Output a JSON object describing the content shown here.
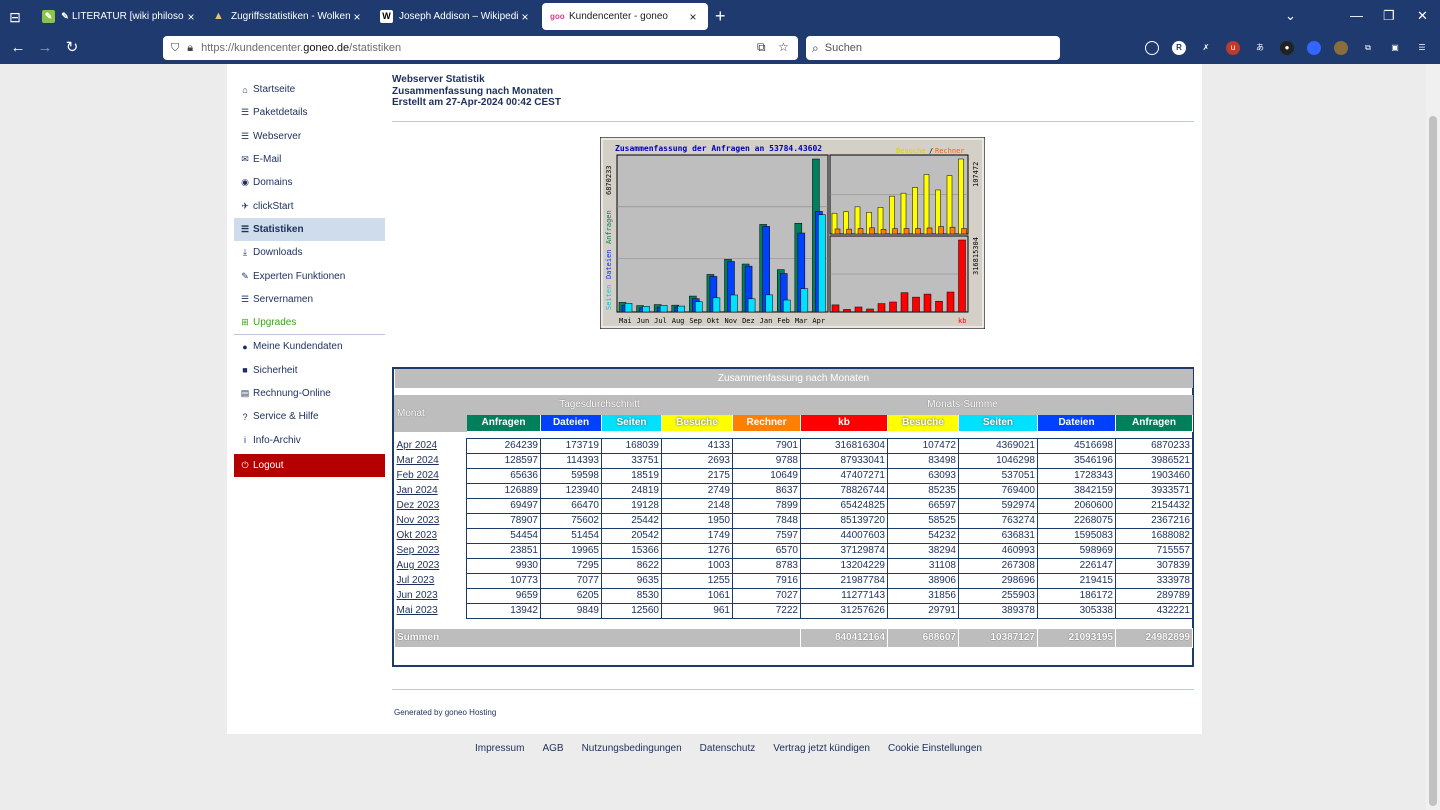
{
  "browser": {
    "tabs": [
      {
        "title": "LITERATUR [wiki philosophie",
        "close": "×"
      },
      {
        "title": "Zugriffsstatistiken - Wolkenstein",
        "close": "×"
      },
      {
        "title": "Joseph Addison – Wikipedia",
        "close": "×"
      },
      {
        "title": "Kundencenter - goneo",
        "close": "×"
      }
    ],
    "new_tab": "+",
    "url_prefix": "https://kundencenter.",
    "url_domain": "goneo.de",
    "url_path": "/statistiken",
    "search_placeholder": "Suchen"
  },
  "sidebar": {
    "items": [
      {
        "label": "Startseite",
        "icon": "home-icon",
        "glyph": "⌂"
      },
      {
        "label": "Paketdetails",
        "icon": "list-icon",
        "glyph": "☰"
      },
      {
        "label": "Webserver",
        "icon": "server-icon",
        "glyph": "☰"
      },
      {
        "label": "E-Mail",
        "icon": "mail-icon",
        "glyph": "✉"
      },
      {
        "label": "Domains",
        "icon": "globe-icon",
        "glyph": "◉"
      },
      {
        "label": "clickStart",
        "icon": "rocket-icon",
        "glyph": "✈"
      },
      {
        "label": "Statistiken",
        "icon": "stats-icon",
        "glyph": "☰"
      },
      {
        "label": "Downloads",
        "icon": "download-icon",
        "glyph": "⤓"
      },
      {
        "label": "Experten Funktionen",
        "icon": "wrench-icon",
        "glyph": "✎"
      },
      {
        "label": "Servernamen",
        "icon": "list-icon",
        "glyph": "☰"
      },
      {
        "label": "Upgrades",
        "icon": "cart-icon",
        "glyph": "⊞"
      },
      {
        "label": "Meine Kundendaten",
        "icon": "user-icon",
        "glyph": "●"
      },
      {
        "label": "Sicherheit",
        "icon": "lock-icon",
        "glyph": "■"
      },
      {
        "label": "Rechnung-Online",
        "icon": "invoice-icon",
        "glyph": "▤"
      },
      {
        "label": "Service & Hilfe",
        "icon": "help-icon",
        "glyph": "?"
      },
      {
        "label": "Info-Archiv",
        "icon": "info-icon",
        "glyph": "i"
      },
      {
        "label": "Logout",
        "icon": "power-icon",
        "glyph": "⏻"
      }
    ]
  },
  "header": {
    "line1": "Webserver Statistik",
    "line2": "Zusammenfassung nach Monaten",
    "line3": "Erstellt am 27-Apr-2024 00:42 CEST"
  },
  "graph": {
    "title": "Zusammenfassung der Anfragen an 53784.43602",
    "legend_visits": "Besuche",
    "legend_slash": "/",
    "legend_hosts": "Rechner",
    "left_axis_max": "6870233",
    "left_axis_label_1": "Seiten",
    "left_axis_label_2": "Dateien",
    "left_axis_label_3": "Anfragen",
    "right_top_max": "107472",
    "right_bottom_max": "316815304",
    "kb_label": "kb",
    "months": [
      "Mai",
      "Jun",
      "Jul",
      "Aug",
      "Sep",
      "Okt",
      "Nov",
      "Dez",
      "Jan",
      "Feb",
      "Mar",
      "Apr"
    ],
    "colors": {
      "hits": "#00805a",
      "files": "#0040ff",
      "pages": "#00e0ff",
      "visits": "#ffff00",
      "sites": "#ff8000",
      "kbytes": "#ff0000"
    }
  },
  "table": {
    "caption": "Zusammenfassung nach Monaten",
    "col_month": "Monat",
    "group_daily": "Tagesdurchschnitt",
    "group_monthly": "Monats-Summe",
    "daily_headers": [
      "Anfragen",
      "Dateien",
      "Seiten",
      "Besuche"
    ],
    "monthly_headers": [
      "Rechner",
      "kb",
      "Besuche",
      "Seiten",
      "Dateien",
      "Anfragen"
    ],
    "rows": [
      {
        "month": "Apr 2024",
        "values": [
          "264239",
          "173719",
          "168039",
          "4133",
          "7901",
          "316816304",
          "107472",
          "4369021",
          "4516698",
          "6870233"
        ]
      },
      {
        "month": "Mar 2024",
        "values": [
          "128597",
          "114393",
          "33751",
          "2693",
          "9788",
          "87933041",
          "83498",
          "1046298",
          "3546196",
          "3986521"
        ]
      },
      {
        "month": "Feb 2024",
        "values": [
          "65636",
          "59598",
          "18519",
          "2175",
          "10649",
          "47407271",
          "63093",
          "537051",
          "1728343",
          "1903460"
        ]
      },
      {
        "month": "Jan 2024",
        "values": [
          "126889",
          "123940",
          "24819",
          "2749",
          "8637",
          "78826744",
          "85235",
          "769400",
          "3842159",
          "3933571"
        ]
      },
      {
        "month": "Dez 2023",
        "values": [
          "69497",
          "66470",
          "19128",
          "2148",
          "7899",
          "65424825",
          "66597",
          "592974",
          "2060600",
          "2154432"
        ]
      },
      {
        "month": "Nov 2023",
        "values": [
          "78907",
          "75602",
          "25442",
          "1950",
          "7848",
          "85139720",
          "58525",
          "763274",
          "2268075",
          "2367216"
        ]
      },
      {
        "month": "Okt 2023",
        "values": [
          "54454",
          "51454",
          "20542",
          "1749",
          "7597",
          "44007603",
          "54232",
          "636831",
          "1595083",
          "1688082"
        ]
      },
      {
        "month": "Sep 2023",
        "values": [
          "23851",
          "19965",
          "15366",
          "1276",
          "6570",
          "37129874",
          "38294",
          "460993",
          "598969",
          "715557"
        ]
      },
      {
        "month": "Aug 2023",
        "values": [
          "9930",
          "7295",
          "8622",
          "1003",
          "8783",
          "13204229",
          "31108",
          "267308",
          "226147",
          "307839"
        ]
      },
      {
        "month": "Jul 2023",
        "values": [
          "10773",
          "7077",
          "9635",
          "1255",
          "7916",
          "21987784",
          "38906",
          "298696",
          "219415",
          "333978"
        ]
      },
      {
        "month": "Jun 2023",
        "values": [
          "9659",
          "6205",
          "8530",
          "1061",
          "7027",
          "11277143",
          "31856",
          "255903",
          "186172",
          "289789"
        ]
      },
      {
        "month": "Mai 2023",
        "values": [
          "13942",
          "9849",
          "12560",
          "961",
          "7222",
          "31257626",
          "29791",
          "389378",
          "305338",
          "432221"
        ]
      }
    ],
    "sum_label": "Summen",
    "sums": [
      "840412164",
      "688607",
      "10387127",
      "21093195",
      "24982899"
    ]
  },
  "generated_by": "Generated by goneo Hosting",
  "footer": [
    "Impressum",
    "AGB",
    "Nutzungsbedingungen",
    "Datenschutz",
    "Vertrag jetzt kündigen",
    "Cookie Einstellungen"
  ]
}
